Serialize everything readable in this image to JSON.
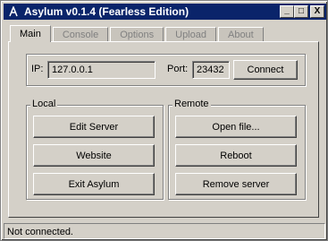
{
  "window": {
    "title": "Asylum v0.1.4 (Fearless Edition)",
    "controls": {
      "minimize": "_",
      "maximize": "□",
      "close": "X"
    },
    "icon": "asylum-app-icon"
  },
  "tabs": [
    {
      "label": "Main",
      "active": true
    },
    {
      "label": "Console",
      "active": false
    },
    {
      "label": "Options",
      "active": false
    },
    {
      "label": "Upload",
      "active": false
    },
    {
      "label": "About",
      "active": false
    }
  ],
  "connection": {
    "ip_label": "IP:",
    "ip_value": "127.0.0.1",
    "port_label": "Port:",
    "port_value": "23432",
    "connect_label": "Connect"
  },
  "local": {
    "title": "Local",
    "buttons": [
      "Edit Server",
      "Website",
      "Exit Asylum"
    ]
  },
  "remote": {
    "title": "Remote",
    "buttons": [
      "Open file...",
      "Reboot",
      "Remove server"
    ]
  },
  "status": {
    "text": "Not connected."
  },
  "colors": {
    "titlebar": "#0a246a",
    "face": "#d4d0c8",
    "disabled_text": "#808080"
  }
}
